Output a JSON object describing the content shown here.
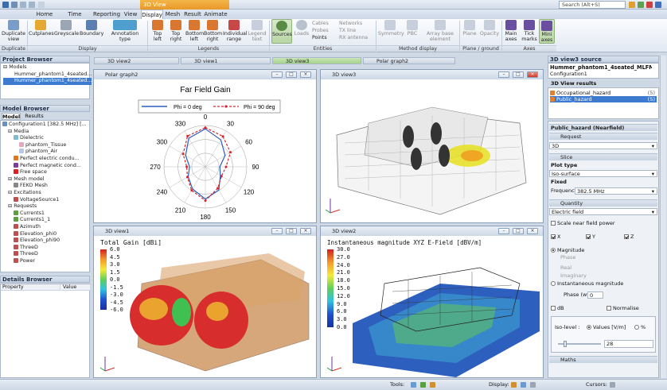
{
  "app": {
    "context_tab": "3D View",
    "search_placeholder": "Search (Alt+S)",
    "tabs": [
      "Home",
      "Time analysis",
      "Reporting",
      "View",
      "Display",
      "Mesh",
      "Result",
      "Animate"
    ],
    "active_tab": "Display"
  },
  "ribbon": {
    "buttons": [
      {
        "label": "Duplicate view",
        "icon": "duplicate-view-icon"
      },
      {
        "label": "Cutplanes",
        "icon": "cutplanes-icon"
      },
      {
        "label": "Greyscale",
        "icon": "greyscale-icon"
      },
      {
        "label": "Boundary",
        "icon": "boundary-icon"
      },
      {
        "label": "Annotation type",
        "icon": "annotation-type-icon"
      },
      {
        "label": "Top left",
        "icon": "legend-top-left-icon"
      },
      {
        "label": "Top right",
        "icon": "legend-top-right-icon"
      },
      {
        "label": "Bottom left",
        "icon": "legend-bottom-left-icon"
      },
      {
        "label": "Bottom right",
        "icon": "legend-bottom-right-icon"
      },
      {
        "label": "Individual range",
        "icon": "individual-range-icon"
      },
      {
        "label": "Legend text",
        "icon": "legend-text-icon"
      },
      {
        "label": "Sources",
        "icon": "sources-icon"
      },
      {
        "label": "Loads",
        "icon": "loads-icon"
      },
      {
        "label": "Symmetry",
        "icon": "symmetry-icon"
      },
      {
        "label": "PBC",
        "icon": "pbc-icon"
      },
      {
        "label": "Array base element",
        "icon": "array-icon"
      },
      {
        "label": "Plane",
        "icon": "plane-icon"
      },
      {
        "label": "Opacity",
        "icon": "opacity-icon"
      },
      {
        "label": "Main axes",
        "icon": "main-axes-icon"
      },
      {
        "label": "Tick marks",
        "icon": "tick-marks-icon"
      },
      {
        "label": "Mini axes",
        "icon": "mini-axes-icon"
      }
    ],
    "entity_items": [
      "Cables",
      "Networks",
      "Probes",
      "TX line",
      "Points",
      "RX antenna"
    ],
    "groups": [
      "Duplicate",
      "Display",
      "Legends",
      "Entities",
      "Method display",
      "Plane / ground",
      "Axes"
    ]
  },
  "project_browser": {
    "title": "Project Browser",
    "models_label": "Models",
    "models": [
      "Hummer_phantom1_4seated...",
      "Hummer_phantom1_4seated..."
    ]
  },
  "model_browser": {
    "title": "Model Browser",
    "tabs": [
      "Model",
      "Results"
    ],
    "tree": [
      {
        "label": "Configuration1 [382.5 MHz] [...",
        "depth": 0,
        "color": "#6a8fc0"
      },
      {
        "label": "Media",
        "depth": 1,
        "color": ""
      },
      {
        "label": "Dielectric",
        "depth": 2,
        "color": "#7fbad0"
      },
      {
        "label": "phantom_Tissue",
        "depth": 3,
        "color": "#e8a7c0"
      },
      {
        "label": "phantom_Air",
        "depth": 3,
        "color": "#b7c7e6"
      },
      {
        "label": "Perfect electric condu...",
        "depth": 2,
        "color": "#e07820"
      },
      {
        "label": "Perfect magnetic cond...",
        "depth": 2,
        "color": "#7c3f9e"
      },
      {
        "label": "Free space",
        "depth": 2,
        "color": "#e02020"
      },
      {
        "label": "Mesh model",
        "depth": 1,
        "color": ""
      },
      {
        "label": "FEKO Mesh",
        "depth": 2,
        "color": "#888888"
      },
      {
        "label": "Excitations",
        "depth": 1,
        "color": ""
      },
      {
        "label": "VoltageSource1",
        "depth": 2,
        "color": "#c0504d"
      },
      {
        "label": "Requests",
        "depth": 1,
        "color": ""
      },
      {
        "label": "Currents1",
        "depth": 2,
        "color": "#5aa040"
      },
      {
        "label": "Currents1_1",
        "depth": 2,
        "color": "#5aa040"
      },
      {
        "label": "Azimuth",
        "depth": 2,
        "color": "#c0504d"
      },
      {
        "label": "Elevation_phi0",
        "depth": 2,
        "color": "#c0504d"
      },
      {
        "label": "Elevation_phi90",
        "depth": 2,
        "color": "#c0504d"
      },
      {
        "label": "ThreeD",
        "depth": 2,
        "color": "#c0504d"
      },
      {
        "label": "ThreeD",
        "depth": 2,
        "color": "#c0504d"
      },
      {
        "label": "Power",
        "depth": 2,
        "color": "#c0504d"
      }
    ]
  },
  "details_browser": {
    "title": "Details Browser",
    "col_property": "Property",
    "col_value": "Value"
  },
  "doc_tabs": [
    "3D view2",
    "3D view1",
    "3D view3",
    "Polar graph2"
  ],
  "active_doc_tab": "3D view3",
  "windows": {
    "polar": {
      "title": "Polar graph2",
      "chart_title": "Far Field Gain",
      "legend": [
        "Phi = 0 deg",
        "Phi = 90 deg"
      ],
      "angle_labels": [
        "330",
        "0",
        "30",
        "300",
        "60",
        "270",
        "90",
        "240",
        "120",
        "210",
        "180",
        "150"
      ]
    },
    "view3": {
      "title": "3D view3"
    },
    "view1": {
      "title": "3D view1",
      "legend_title": "Total Gain [dBi]",
      "legend_values": [
        "6.0",
        "4.5",
        "3.0",
        "1.5",
        "0.0",
        "-1.5",
        "-3.0",
        "-4.5",
        "-6.0"
      ]
    },
    "view2": {
      "title": "3D view2",
      "legend_title": "Instantaneous magnitude XYZ E-Field [dBV/m]",
      "legend_values": [
        "30.0",
        "27.0",
        "24.0",
        "21.0",
        "18.0",
        "15.0",
        "12.0",
        "9.0",
        "6.0",
        "3.0",
        "0.0"
      ]
    }
  },
  "chart_data": {
    "type": "line",
    "title": "Far Field Gain",
    "coordinate_system": "polar",
    "angle_unit": "deg",
    "radial_tick_labels_shown": false,
    "series": [
      {
        "name": "Phi = 0 deg",
        "color": "#2a5dbf",
        "style": "solid",
        "theta": [
          0,
          30,
          60,
          90,
          120,
          150,
          180,
          210,
          240,
          270,
          300,
          330
        ],
        "r": [
          0.92,
          0.75,
          0.55,
          0.35,
          0.42,
          0.65,
          0.78,
          0.62,
          0.48,
          0.38,
          0.55,
          0.8
        ]
      },
      {
        "name": "Phi = 90 deg",
        "color": "#d7262b",
        "style": "dashed",
        "theta": [
          0,
          30,
          60,
          90,
          120,
          150,
          180,
          210,
          240,
          270,
          300,
          330
        ],
        "r": [
          0.95,
          0.85,
          0.7,
          0.5,
          0.45,
          0.6,
          0.82,
          0.66,
          0.5,
          0.45,
          0.62,
          0.86
        ]
      }
    ]
  },
  "source_panel": {
    "title": "3D view3 source",
    "model": "Hummer_phantom1_4seated_MLFMM_cust",
    "config": "Configuration1",
    "results_title": "3D View results",
    "results": [
      "Occupational_hazard",
      "Public_hazard"
    ],
    "results_badges": [
      "(5)",
      "(5)"
    ],
    "section_title": "Public_hazard (Nearfield)",
    "request_label": "Request",
    "request_value": "3D",
    "slice_label": "Slice",
    "plot_type_label": "Plot type",
    "plot_type_value": "Iso-surface",
    "fixed_label": "Fixed",
    "frequency_label": "Frequency",
    "frequency_value": "382.5 MHz",
    "quantity_label": "Quantity",
    "quantity_value": "Electric field",
    "scale_near_field": "Scale near field power",
    "x": "X",
    "y": "Y",
    "z": "Z",
    "magnitude": "Magnitude",
    "phase": "Phase",
    "real": "Real",
    "imaginary": "Imaginary",
    "inst_mag": "Instantaneous magnitude",
    "phase_wt_label": "Phase (wt)",
    "phase_wt_value": "0",
    "db": "dB",
    "normalise": "Normalise",
    "iso_level_label": "Iso-level :",
    "values_label": "Values [V/m]",
    "percent_label": "%",
    "iso_value": "28",
    "maths_label": "Maths"
  },
  "statusbar": {
    "tools": "Tools:",
    "display": "Display:",
    "cursors": "Cursors:"
  }
}
